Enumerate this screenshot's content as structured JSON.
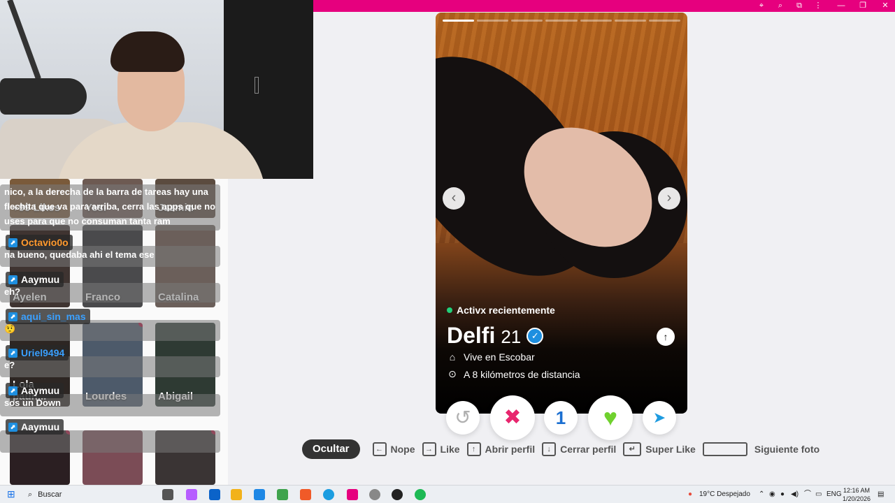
{
  "browser": {
    "controls": [
      "⌖",
      "⌕",
      "⧉",
      "⋮",
      "—",
      "❐",
      "✕"
    ]
  },
  "stream_grid": {
    "tiles": [
      {
        "name": "+99 Likes",
        "color": "#7a5a3a"
      },
      {
        "name": "Yesi",
        "color": "#6d5a52"
      },
      {
        "name": "Jazmin",
        "color": "#5b4b3f"
      },
      {
        "name": "Ayelen",
        "color": "#3f3431"
      },
      {
        "name": "Franco",
        "color": "#4a4a4c"
      },
      {
        "name": "Catalina",
        "color": "#6b5f5a"
      },
      {
        "name": "Lola paun...",
        "color": "#2d2623"
      },
      {
        "name": "Lourdes",
        "color": "#4d5a6a"
      },
      {
        "name": "Abigail",
        "color": "#2e3a33"
      },
      {
        "name": "",
        "color": "#2b1f22"
      },
      {
        "name": "",
        "color": "#7b4c56"
      },
      {
        "name": "",
        "color": "#3a3434"
      }
    ]
  },
  "chat": {
    "messages": [
      {
        "user": "",
        "user_color": "#ff9a2e",
        "text": "nico, a la derecha de la barra de tareas hay una flechita que va para arriba, cerra las apps que no uses para que no consuman tanta ram"
      },
      {
        "user": "Octavio0o",
        "user_color": "#ff9a2e",
        "text": "na bueno, quedaba ahi el tema ese"
      },
      {
        "user": "Aaymuu",
        "user_color": "#ffffff",
        "text": "eh?"
      },
      {
        "user": "aqui_sin_mas",
        "user_color": "#3aa0ff",
        "text": "🤨"
      },
      {
        "user": "Uriel9494",
        "user_color": "#3aa0ff",
        "text": "e?"
      },
      {
        "user": "Aaymuu",
        "user_color": "#ffffff",
        "text": "sos un Down"
      },
      {
        "user": "Aaymuu",
        "user_color": "#ffffff",
        "text": ""
      }
    ]
  },
  "profile": {
    "status": "Activx recientemente",
    "name": "Delfi",
    "age": "21",
    "verified_icon": "✓",
    "lives_in": "Vive en Escobar",
    "distance": "A 8 kilómetros de distancia",
    "photos_total": 7,
    "photo_current": 1
  },
  "actions": {
    "rewind": "↺",
    "nope": "✖",
    "boost": "1",
    "like": "♥",
    "super": "➤"
  },
  "shortcuts": {
    "hide": "Ocultar",
    "nope_key": "←",
    "nope": "Nope",
    "like_key": "→",
    "like": "Like",
    "open_key": "↑",
    "open": "Abrir perfil",
    "close_key": "↓",
    "close": "Cerrar perfil",
    "super_key": "↵",
    "super": "Super Like",
    "next": "Siguiente foto"
  },
  "taskbar": {
    "search": "Buscar",
    "weather": "19°C  Despejado",
    "lang": "ENG",
    "time": "12:16 AM",
    "date": "1/20/2026"
  },
  "colors": {
    "accent_pink": "#e6007e",
    "nope_red": "#e8266e",
    "like_green": "#2ecc71",
    "boost_blue": "#1b6fd1",
    "super_blue": "#1e9be0"
  }
}
